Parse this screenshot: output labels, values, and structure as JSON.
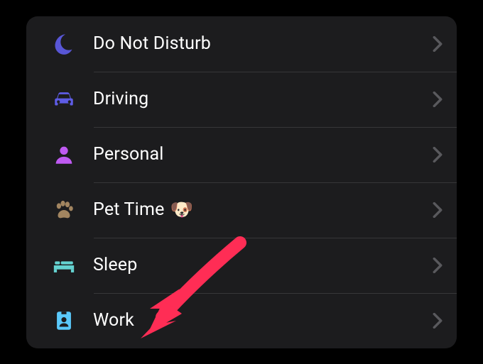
{
  "focus_modes": {
    "items": [
      {
        "id": "dnd",
        "label": "Do Not Disturb",
        "icon": "moon-icon",
        "icon_color": "#5856d6",
        "emoji": ""
      },
      {
        "id": "driving",
        "label": "Driving",
        "icon": "car-icon",
        "icon_color": "#5e5ce6",
        "emoji": ""
      },
      {
        "id": "personal",
        "label": "Personal",
        "icon": "person-icon",
        "icon_color": "#bf5af2",
        "emoji": ""
      },
      {
        "id": "pet",
        "label": "Pet Time",
        "icon": "paw-icon",
        "icon_color": "#a28560",
        "emoji": "🐶"
      },
      {
        "id": "sleep",
        "label": "Sleep",
        "icon": "bed-icon",
        "icon_color": "#64d2d0",
        "emoji": ""
      },
      {
        "id": "work",
        "label": "Work",
        "icon": "badge-icon",
        "icon_color": "#5ac8fa",
        "emoji": ""
      }
    ]
  },
  "annotation": {
    "type": "arrow",
    "color": "#ff2d55",
    "points_to": "work"
  }
}
